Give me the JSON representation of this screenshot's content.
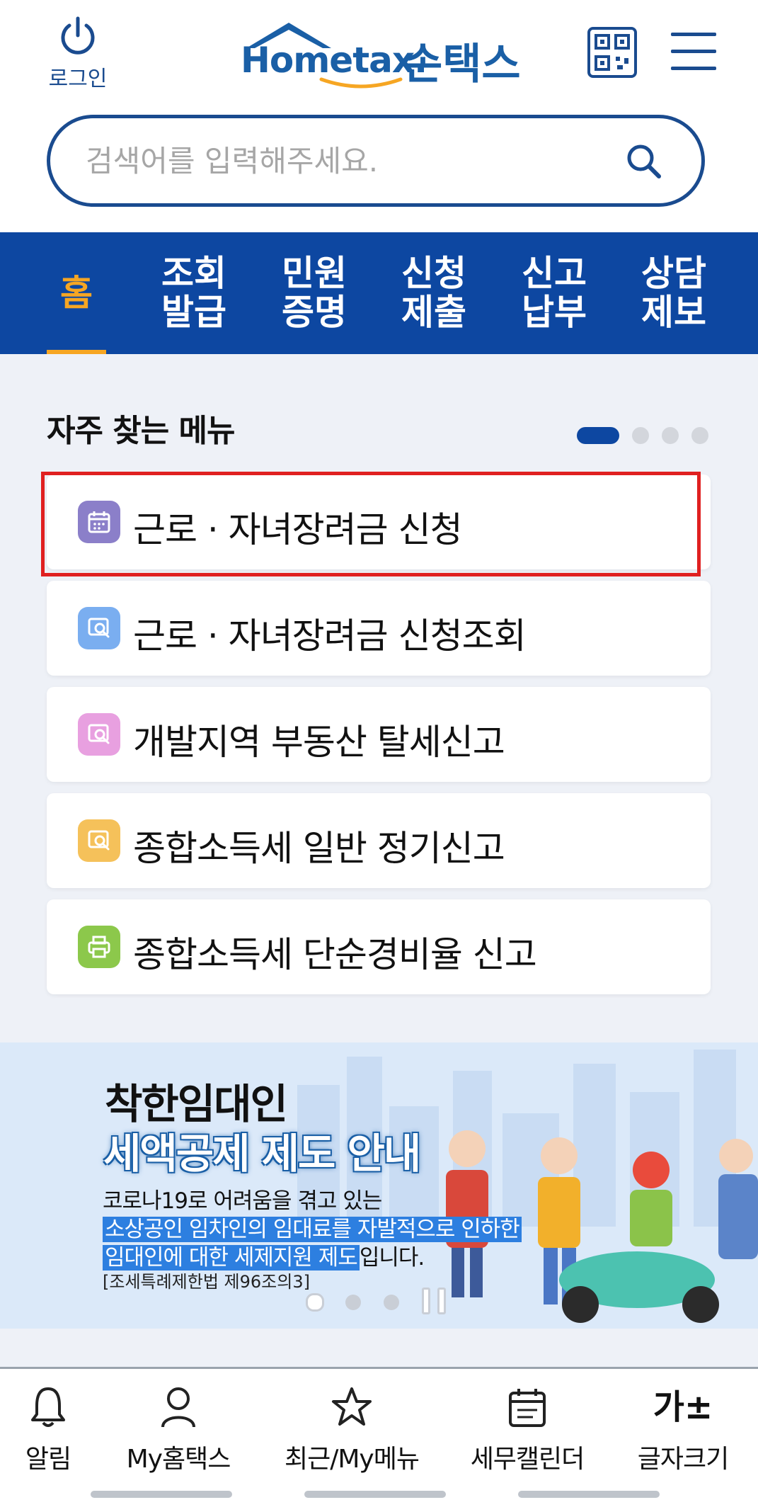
{
  "header": {
    "login_label": "로그인",
    "logo_en": "Hometax.",
    "logo_ko": "손택스"
  },
  "search": {
    "placeholder": "검색어를 입력해주세요."
  },
  "nav": {
    "items": [
      {
        "label": "홈",
        "active": true
      },
      {
        "label": "조회\n발급"
      },
      {
        "label": "민원\n증명"
      },
      {
        "label": "신청\n제출"
      },
      {
        "label": "신고\n납부"
      },
      {
        "label": "상담\n제보"
      }
    ]
  },
  "frequent": {
    "title": "자주 찾는 메뉴",
    "page_count": 4,
    "current_page": 1,
    "items": [
      {
        "label": "근로 · 자녀장려금 신청",
        "icon": "calendar-icon",
        "color": "#8b7fc9",
        "highlighted": true
      },
      {
        "label": "근로 · 자녀장려금 신청조회",
        "icon": "search-document-icon",
        "color": "#7aaef0"
      },
      {
        "label": "개발지역 부동산 탈세신고",
        "icon": "search-document-icon",
        "color": "#e8a0e0"
      },
      {
        "label": "종합소득세 일반 정기신고",
        "icon": "search-document-icon",
        "color": "#f5c15a"
      },
      {
        "label": "종합소득세 단순경비율 신고",
        "icon": "printer-icon",
        "color": "#8cc84b"
      }
    ]
  },
  "banner": {
    "title1": "착한임대인",
    "title2": "세액공제 제도 안내",
    "line1": "코로나19로 어려움을 겪고 있는",
    "line2": "소상공인 임차인의 임대료를 자발적으로 인하한",
    "line3_hl": "임대인에 대한 세제지원 제도",
    "line3_rest": "입니다.",
    "law": "[조세특례제한법 제96조의3]",
    "slide_count": 3,
    "current_slide": 1
  },
  "bottom_tabs": [
    {
      "label": "알림",
      "icon": "bell-icon"
    },
    {
      "label": "My홈택스",
      "icon": "person-icon"
    },
    {
      "label": "최근/My메뉴",
      "icon": "star-icon"
    },
    {
      "label": "세무캘린더",
      "icon": "calendar-icon"
    },
    {
      "label": "글자크기",
      "icon": "font-size-icon",
      "glyph": "가±"
    }
  ],
  "colors": {
    "brand": "#0d47a1",
    "accent": "#f6a623",
    "highlight_border": "#e02020"
  }
}
